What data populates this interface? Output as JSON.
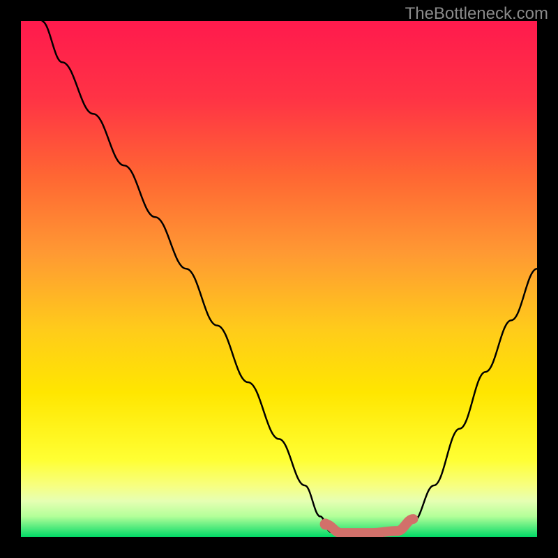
{
  "watermark": "TheBottleneck.com",
  "chart_data": {
    "type": "line",
    "title": "",
    "xlabel": "",
    "ylabel": "",
    "xlim": [
      0,
      100
    ],
    "ylim": [
      0,
      100
    ],
    "background_gradient": {
      "top": "#ff1a4d",
      "upper_mid": "#ff9933",
      "mid": "#ffe600",
      "lower": "#ffff66",
      "band": "#e6ffb3",
      "bottom": "#00d966"
    },
    "series": [
      {
        "name": "main-curve",
        "color": "#000000",
        "points": [
          {
            "x": 4,
            "y": 100
          },
          {
            "x": 8,
            "y": 92
          },
          {
            "x": 14,
            "y": 82
          },
          {
            "x": 20,
            "y": 72
          },
          {
            "x": 26,
            "y": 62
          },
          {
            "x": 32,
            "y": 52
          },
          {
            "x": 38,
            "y": 41
          },
          {
            "x": 44,
            "y": 30
          },
          {
            "x": 50,
            "y": 19
          },
          {
            "x": 55,
            "y": 10
          },
          {
            "x": 58,
            "y": 4
          },
          {
            "x": 60,
            "y": 1
          },
          {
            "x": 63,
            "y": 0
          },
          {
            "x": 68,
            "y": 0
          },
          {
            "x": 73,
            "y": 0.5
          },
          {
            "x": 76,
            "y": 3
          },
          {
            "x": 80,
            "y": 10
          },
          {
            "x": 85,
            "y": 21
          },
          {
            "x": 90,
            "y": 32
          },
          {
            "x": 95,
            "y": 42
          },
          {
            "x": 100,
            "y": 52
          }
        ]
      },
      {
        "name": "optimal-range-marker",
        "color": "#d2706a",
        "points": [
          {
            "x": 59,
            "y": 2.5
          },
          {
            "x": 62,
            "y": 0.8
          },
          {
            "x": 68,
            "y": 0.8
          },
          {
            "x": 73,
            "y": 1.2
          },
          {
            "x": 76,
            "y": 3.5
          }
        ]
      }
    ],
    "markers": [
      {
        "name": "optimal-point",
        "x": 59,
        "y": 2.5,
        "color": "#d2706a"
      }
    ]
  }
}
